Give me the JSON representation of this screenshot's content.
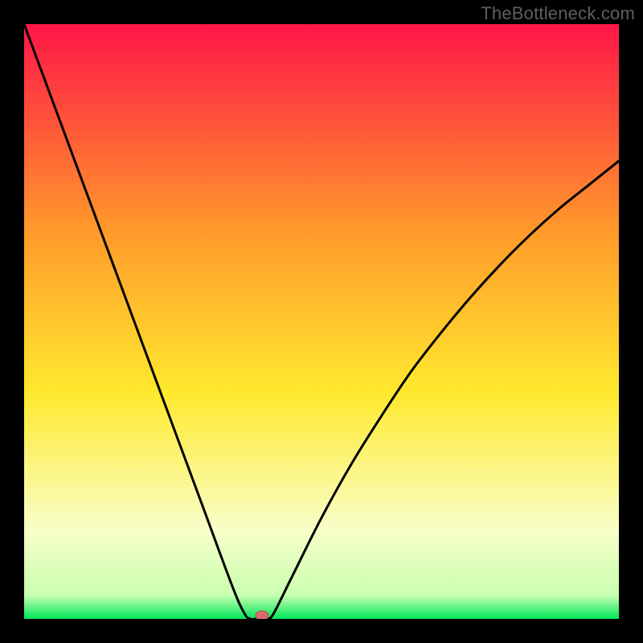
{
  "watermark": "TheBottleneck.com",
  "colors": {
    "bg": "#000000",
    "watermark": "#5f5f5f",
    "curve": "#000000",
    "marker_fill": "#d96d6d",
    "marker_stroke": "#b94c4c",
    "gradient_top": "#ff1648",
    "gradient_orange": "#ff9a2a",
    "gradient_yellow": "#ffe92e",
    "gradient_pale": "#f8ffc8",
    "gradient_green": "#00e85a"
  },
  "chart_data": {
    "type": "line",
    "title": "",
    "xlabel": "",
    "ylabel": "",
    "xlim": [
      0,
      100
    ],
    "ylim": [
      0,
      100
    ],
    "grid": false,
    "legend": false,
    "series": [
      {
        "name": "curve",
        "x": [
          0,
          5,
          10,
          15,
          20,
          25,
          30,
          35,
          37,
          38,
          39,
          40,
          41,
          42,
          45,
          50,
          55,
          60,
          65,
          70,
          75,
          80,
          85,
          90,
          95,
          100
        ],
        "y": [
          100,
          86.5,
          73,
          59.5,
          46,
          32.5,
          19,
          5.5,
          1,
          0,
          0,
          0,
          0,
          1,
          7,
          17,
          26,
          34,
          41.5,
          48,
          54,
          59.5,
          64.5,
          69,
          73,
          77
        ]
      }
    ],
    "marker": {
      "x": 40,
      "y": 0
    },
    "annotations": []
  }
}
